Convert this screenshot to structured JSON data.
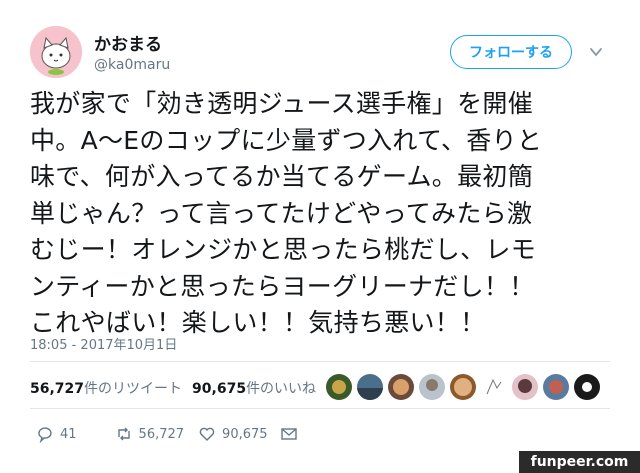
{
  "user": {
    "display_name": "かおまる",
    "handle": "@ka0maru"
  },
  "follow_button": {
    "label": "フォローする"
  },
  "tweet": {
    "text": "我が家で「効き透明ジュース選手権」を開催\n中。A～Eのコップに少量ずつ入れて、香りと\n味で、何が入ってるか当てるゲーム。最初簡\n単じゃん？って言ってたけどやってみたら激\nむじー！オレンジかと思ったら桃だし、レモ\nンティーかと思ったらヨーグリーナだし！！\nこれやばい！楽しい！！気持ち悪い！！",
    "timestamp": "18:05 - 2017年10月1日"
  },
  "stats": {
    "retweets_count": "56,727",
    "retweets_label": "件のリツイート",
    "likes_count": "90,675",
    "likes_label": "件のいいね"
  },
  "likers": [
    "liker-1",
    "liker-2",
    "liker-3",
    "liker-4",
    "liker-5",
    "liker-6",
    "liker-7",
    "liker-8",
    "liker-9"
  ],
  "actions": {
    "reply_count": "41",
    "retweet_count": "56,727",
    "like_count": "90,675"
  },
  "watermark": {
    "text": "funpeer.com"
  },
  "colors": {
    "accent": "#1da1f2",
    "muted": "#657786",
    "text": "#14171a"
  }
}
